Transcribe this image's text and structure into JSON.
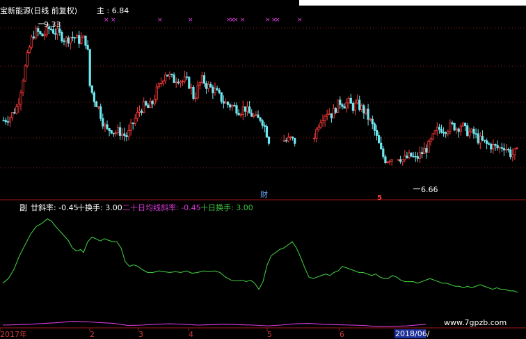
{
  "top_panel": {
    "title": "宝新能源(日线 前复权)",
    "main_label": "主 : 6.84",
    "high_label": "9.33",
    "low_label": "6.66",
    "event_cai": "财",
    "event_five": "5"
  },
  "bottom_panel": {
    "label_prefix": "副",
    "legend_1": "廿斜率: -0.45",
    "legend_2": "十换手: 3.00",
    "legend_3": "二十日均线斜率: -0.45",
    "legend_4": "十日换手: 3.00"
  },
  "x_axis": {
    "ticks": [
      "2017年",
      "2",
      "3",
      "4",
      "5",
      "6"
    ],
    "date_box": "2018/06/",
    "watermark": "www.7gpzb.com"
  },
  "colors": {
    "background": "#000000",
    "up": "#ff3b3b",
    "down": "#6fe8f0",
    "line_green": "#3ec43e",
    "line_magenta": "#d63ad6",
    "marker": "#e040e0",
    "grid": "#8a1a1a",
    "divider": "#a01818"
  },
  "chart_data": [
    {
      "type": "candlestick",
      "title": "宝新能源(日线 前复权)",
      "ylim": [
        6.0,
        9.6
      ],
      "annotations": [
        {
          "text": "9.33",
          "x": "2017-01",
          "y": 9.33
        },
        {
          "text": "6.66",
          "x": "2018-06",
          "y": 6.66
        }
      ],
      "close_path": [
        [
          0,
          7.45
        ],
        [
          10,
          7.52
        ],
        [
          20,
          7.72
        ],
        [
          28,
          8.25
        ],
        [
          36,
          8.75
        ],
        [
          42,
          9.05
        ],
        [
          48,
          9.12
        ],
        [
          54,
          9.02
        ],
        [
          60,
          9.08
        ],
        [
          66,
          9.18
        ],
        [
          72,
          9.12
        ],
        [
          78,
          9.08
        ],
        [
          84,
          9.02
        ],
        [
          90,
          8.95
        ],
        [
          96,
          9.02
        ],
        [
          102,
          9.0
        ],
        [
          108,
          8.95
        ],
        [
          114,
          8.98
        ],
        [
          120,
          8.9
        ],
        [
          124,
          8.1
        ],
        [
          130,
          7.85
        ],
        [
          136,
          7.7
        ],
        [
          142,
          7.45
        ],
        [
          148,
          7.25
        ],
        [
          154,
          7.3
        ],
        [
          160,
          7.22
        ],
        [
          166,
          7.25
        ],
        [
          172,
          7.18
        ],
        [
          178,
          7.15
        ],
        [
          184,
          7.35
        ],
        [
          190,
          7.5
        ],
        [
          196,
          7.65
        ],
        [
          202,
          7.72
        ],
        [
          208,
          7.68
        ],
        [
          214,
          7.78
        ],
        [
          220,
          8.0
        ],
        [
          226,
          8.15
        ],
        [
          232,
          8.35
        ],
        [
          238,
          8.28
        ],
        [
          244,
          8.2
        ],
        [
          250,
          8.25
        ],
        [
          256,
          8.18
        ],
        [
          262,
          8.2
        ],
        [
          268,
          8.1
        ],
        [
          274,
          7.85
        ],
        [
          280,
          8.1
        ],
        [
          286,
          8.22
        ],
        [
          292,
          8.1
        ],
        [
          298,
          8.05
        ],
        [
          304,
          8.0
        ],
        [
          310,
          7.9
        ],
        [
          316,
          7.8
        ],
        [
          322,
          7.75
        ],
        [
          328,
          7.72
        ],
        [
          334,
          7.68
        ],
        [
          340,
          7.62
        ],
        [
          346,
          7.7
        ],
        [
          352,
          7.58
        ],
        [
          358,
          7.55
        ],
        [
          364,
          7.45
        ],
        [
          370,
          7.5
        ],
        [
          376,
          7.3
        ],
        [
          382,
          7.05
        ],
        [
          388,
          7.08
        ],
        [
          394,
          7.05
        ],
        [
          400,
          7.1
        ],
        [
          406,
          7.06
        ],
        [
          412,
          7.1
        ],
        [
          418,
          7.05
        ],
        [
          424,
          7.08
        ],
        [
          430,
          7.05
        ],
        [
          436,
          7.06
        ],
        [
          442,
          7.1
        ],
        [
          448,
          7.2
        ],
        [
          454,
          7.45
        ],
        [
          460,
          7.55
        ],
        [
          466,
          7.62
        ],
        [
          472,
          7.55
        ],
        [
          478,
          7.7
        ],
        [
          484,
          7.8
        ],
        [
          490,
          7.75
        ],
        [
          496,
          7.78
        ],
        [
          502,
          7.7
        ],
        [
          508,
          7.75
        ],
        [
          514,
          7.68
        ],
        [
          520,
          7.6
        ],
        [
          526,
          7.45
        ],
        [
          532,
          7.3
        ],
        [
          538,
          7.05
        ],
        [
          544,
          6.8
        ],
        [
          550,
          6.7
        ],
        [
          556,
          6.75
        ],
        [
          562,
          6.72
        ],
        [
          568,
          6.78
        ],
        [
          574,
          6.7
        ],
        [
          580,
          6.75
        ],
        [
          586,
          6.78
        ],
        [
          592,
          6.72
        ],
        [
          598,
          6.8
        ],
        [
          604,
          6.88
        ],
        [
          610,
          6.95
        ],
        [
          616,
          7.1
        ],
        [
          622,
          7.25
        ],
        [
          628,
          7.3
        ],
        [
          634,
          7.28
        ],
        [
          640,
          7.32
        ],
        [
          646,
          7.35
        ],
        [
          652,
          7.3
        ],
        [
          658,
          7.38
        ],
        [
          664,
          7.25
        ],
        [
          670,
          7.22
        ],
        [
          676,
          7.2
        ],
        [
          682,
          7.1
        ],
        [
          688,
          7.05
        ],
        [
          694,
          7.0
        ],
        [
          700,
          6.98
        ],
        [
          706,
          6.95
        ],
        [
          712,
          6.92
        ],
        [
          718,
          6.98
        ],
        [
          724,
          6.9
        ],
        [
          730,
          6.8
        ],
        [
          736,
          6.85
        ],
        [
          742,
          6.84
        ]
      ]
    },
    {
      "type": "line",
      "series": [
        {
          "name": "廿斜率",
          "color": "green",
          "ylim": [
            0,
            100
          ],
          "points": [
            [
              0,
              12
            ],
            [
              8,
              18
            ],
            [
              16,
              30
            ],
            [
              24,
              48
            ],
            [
              32,
              62
            ],
            [
              40,
              76
            ],
            [
              48,
              86
            ],
            [
              56,
              90
            ],
            [
              64,
              96
            ],
            [
              70,
              93
            ],
            [
              76,
              86
            ],
            [
              82,
              80
            ],
            [
              88,
              74
            ],
            [
              94,
              68
            ],
            [
              100,
              58
            ],
            [
              106,
              54
            ],
            [
              112,
              56
            ],
            [
              116,
              52
            ],
            [
              122,
              66
            ],
            [
              128,
              72
            ],
            [
              134,
              70
            ],
            [
              140,
              67
            ],
            [
              146,
              70
            ],
            [
              152,
              68
            ],
            [
              158,
              66
            ],
            [
              164,
              66
            ],
            [
              170,
              58
            ],
            [
              176,
              40
            ],
            [
              182,
              34
            ],
            [
              188,
              36
            ],
            [
              194,
              34
            ],
            [
              200,
              30
            ],
            [
              208,
              26
            ],
            [
              216,
              26
            ],
            [
              224,
              28
            ],
            [
              232,
              27
            ],
            [
              240,
              26
            ],
            [
              248,
              27
            ],
            [
              256,
              26
            ],
            [
              264,
              28
            ],
            [
              272,
              25
            ],
            [
              280,
              26
            ],
            [
              288,
              28
            ],
            [
              296,
              27
            ],
            [
              304,
              28
            ],
            [
              312,
              26
            ],
            [
              320,
              20
            ],
            [
              328,
              16
            ],
            [
              336,
              15
            ],
            [
              344,
              16
            ],
            [
              350,
              14
            ],
            [
              356,
              16
            ],
            [
              362,
              12
            ],
            [
              368,
              4
            ],
            [
              374,
              14
            ],
            [
              380,
              36
            ],
            [
              386,
              48
            ],
            [
              392,
              52
            ],
            [
              398,
              56
            ],
            [
              404,
              58
            ],
            [
              410,
              62
            ],
            [
              416,
              66
            ],
            [
              422,
              58
            ],
            [
              428,
              46
            ],
            [
              434,
              32
            ],
            [
              440,
              20
            ],
            [
              446,
              18
            ],
            [
              452,
              20
            ],
            [
              458,
              22
            ],
            [
              464,
              24
            ],
            [
              470,
              22
            ],
            [
              476,
              26
            ],
            [
              482,
              28
            ],
            [
              488,
              34
            ],
            [
              494,
              32
            ],
            [
              500,
              30
            ],
            [
              506,
              28
            ],
            [
              512,
              26
            ],
            [
              518,
              26
            ],
            [
              524,
              24
            ],
            [
              530,
              22
            ],
            [
              536,
              24
            ],
            [
              542,
              20
            ],
            [
              548,
              18
            ],
            [
              554,
              18
            ],
            [
              560,
              22
            ],
            [
              566,
              20
            ],
            [
              572,
              16
            ],
            [
              578,
              14
            ],
            [
              584,
              14
            ],
            [
              590,
              14
            ],
            [
              596,
              12
            ],
            [
              602,
              14
            ],
            [
              608,
              16
            ],
            [
              614,
              18
            ],
            [
              620,
              16
            ],
            [
              626,
              14
            ],
            [
              632,
              12
            ],
            [
              638,
              12
            ],
            [
              644,
              10
            ],
            [
              650,
              8
            ],
            [
              656,
              8
            ],
            [
              662,
              6
            ],
            [
              668,
              8
            ],
            [
              674,
              6
            ],
            [
              680,
              8
            ],
            [
              686,
              10
            ],
            [
              692,
              8
            ],
            [
              698,
              6
            ],
            [
              704,
              4
            ],
            [
              710,
              6
            ],
            [
              716,
              4
            ],
            [
              722,
              4
            ],
            [
              728,
              2
            ],
            [
              734,
              2
            ],
            [
              740,
              0
            ]
          ]
        },
        {
          "name": "二十日均线斜率",
          "color": "magenta",
          "ylim": [
            0,
            100
          ],
          "points": [
            [
              0,
              10
            ],
            [
              20,
              12
            ],
            [
              40,
              14
            ],
            [
              60,
              18
            ],
            [
              80,
              22
            ],
            [
              100,
              28
            ],
            [
              120,
              26
            ],
            [
              140,
              22
            ],
            [
              160,
              18
            ],
            [
              180,
              8
            ],
            [
              200,
              10
            ],
            [
              220,
              14
            ],
            [
              240,
              16
            ],
            [
              260,
              14
            ],
            [
              280,
              10
            ],
            [
              300,
              12
            ],
            [
              320,
              14
            ],
            [
              340,
              12
            ],
            [
              360,
              10
            ],
            [
              380,
              6
            ],
            [
              400,
              10
            ],
            [
              420,
              16
            ],
            [
              440,
              18
            ],
            [
              460,
              14
            ],
            [
              480,
              12
            ],
            [
              500,
              10
            ],
            [
              520,
              8
            ],
            [
              540,
              2
            ],
            [
              560,
              4
            ],
            [
              580,
              6
            ],
            [
              600,
              12
            ],
            [
              608,
              14
            ]
          ]
        }
      ]
    }
  ]
}
